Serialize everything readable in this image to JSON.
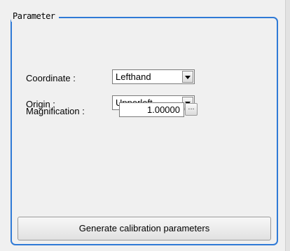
{
  "parameter_group": {
    "title": "Parameter",
    "coordinate": {
      "label": "Coordinate :",
      "value": "Lefthand"
    },
    "origin": {
      "label": "Origin :",
      "value": "Upperleft"
    },
    "magnification": {
      "label": "Magnification :",
      "value": "1.00000",
      "button_label": "..."
    },
    "generate_button": {
      "label": "Generate calibration parameters"
    }
  },
  "icons": {
    "dropdown_arrow": "chevron-down-icon"
  },
  "colors": {
    "panel_background": "#f0f0f0",
    "group_border": "#2f7ad6"
  }
}
